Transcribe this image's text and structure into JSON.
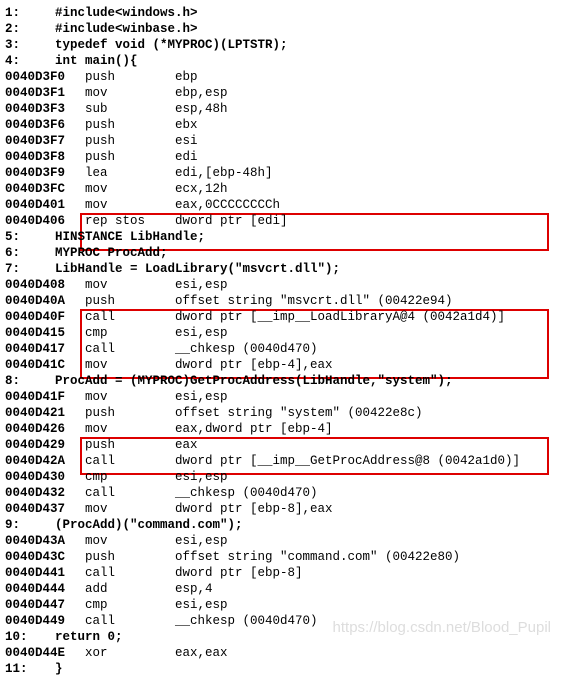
{
  "src": {
    "l1n": "1:",
    "l1": "#include<windows.h>",
    "l2n": "2:",
    "l2": "#include<winbase.h>",
    "l3n": "3:",
    "l3": "typedef void (*MYPROC)(LPTSTR);",
    "l4n": "4:",
    "l4": "int main(){",
    "l5n": "5:",
    "l5": "HINSTANCE LibHandle;",
    "l6n": "6:",
    "l6": "MYPROC ProcAdd;",
    "l7n": "7:",
    "l7": "LibHandle = LoadLibrary(\"msvcrt.dll\");",
    "l8n": "8:",
    "l8": "ProcAdd = (MYPROC)GetProcAddress(LibHandle,\"system\");",
    "l9n": "9:",
    "l9": "(ProcAdd)(\"command.com\");",
    "l10n": "10:",
    "l10": "return 0;",
    "l11n": "11:",
    "l11": "}"
  },
  "asm": {
    "r1": {
      "a": "0040D3F0",
      "m": "push",
      "o": "ebp"
    },
    "r2": {
      "a": "0040D3F1",
      "m": "mov",
      "o": "ebp,esp"
    },
    "r3": {
      "a": "0040D3F3",
      "m": "sub",
      "o": "esp,48h"
    },
    "r4": {
      "a": "0040D3F6",
      "m": "push",
      "o": "ebx"
    },
    "r5": {
      "a": "0040D3F7",
      "m": "push",
      "o": "esi"
    },
    "r6": {
      "a": "0040D3F8",
      "m": "push",
      "o": "edi"
    },
    "r7": {
      "a": "0040D3F9",
      "m": "lea",
      "o": "edi,[ebp-48h]"
    },
    "r8": {
      "a": "0040D3FC",
      "m": "mov",
      "o": "ecx,12h"
    },
    "r9": {
      "a": "0040D401",
      "m": "mov",
      "o": "eax,0CCCCCCCCh"
    },
    "r10": {
      "a": "0040D406",
      "m": "rep stos",
      "o": "dword ptr [edi]"
    },
    "r11": {
      "a": "0040D408",
      "m": "mov",
      "o": "esi,esp"
    },
    "r12": {
      "a": "0040D40A",
      "m": "push",
      "o": "offset string \"msvcrt.dll\" (00422e94)"
    },
    "r13": {
      "a": "0040D40F",
      "m": "call",
      "o": "dword ptr [__imp__LoadLibraryA@4 (0042a1d4)]"
    },
    "r14": {
      "a": "0040D415",
      "m": "cmp",
      "o": "esi,esp"
    },
    "r15": {
      "a": "0040D417",
      "m": "call",
      "o": "__chkesp (0040d470)"
    },
    "r16": {
      "a": "0040D41C",
      "m": "mov",
      "o": "dword ptr [ebp-4],eax"
    },
    "r17": {
      "a": "0040D41F",
      "m": "mov",
      "o": "esi,esp"
    },
    "r18": {
      "a": "0040D421",
      "m": "push",
      "o": "offset string \"system\" (00422e8c)"
    },
    "r19": {
      "a": "0040D426",
      "m": "mov",
      "o": "eax,dword ptr [ebp-4]"
    },
    "r20": {
      "a": "0040D429",
      "m": "push",
      "o": "eax"
    },
    "r21": {
      "a": "0040D42A",
      "m": "call",
      "o": "dword ptr [__imp__GetProcAddress@8 (0042a1d0)]"
    },
    "r22": {
      "a": "0040D430",
      "m": "cmp",
      "o": "esi,esp"
    },
    "r23": {
      "a": "0040D432",
      "m": "call",
      "o": "__chkesp (0040d470)"
    },
    "r24": {
      "a": "0040D437",
      "m": "mov",
      "o": "dword ptr [ebp-8],eax"
    },
    "r25": {
      "a": "0040D43A",
      "m": "mov",
      "o": "esi,esp"
    },
    "r26": {
      "a": "0040D43C",
      "m": "push",
      "o": "offset string \"command.com\" (00422e80)"
    },
    "r27": {
      "a": "0040D441",
      "m": "call",
      "o": "dword ptr [ebp-8]"
    },
    "r28": {
      "a": "0040D444",
      "m": "add",
      "o": "esp,4"
    },
    "r29": {
      "a": "0040D447",
      "m": "cmp",
      "o": "esi,esp"
    },
    "r30": {
      "a": "0040D449",
      "m": "call",
      "o": "__chkesp (0040d470)"
    },
    "r31": {
      "a": "0040D44E",
      "m": "xor",
      "o": "eax,eax"
    }
  },
  "watermark": "https://blog.csdn.net/Blood_Pupil"
}
